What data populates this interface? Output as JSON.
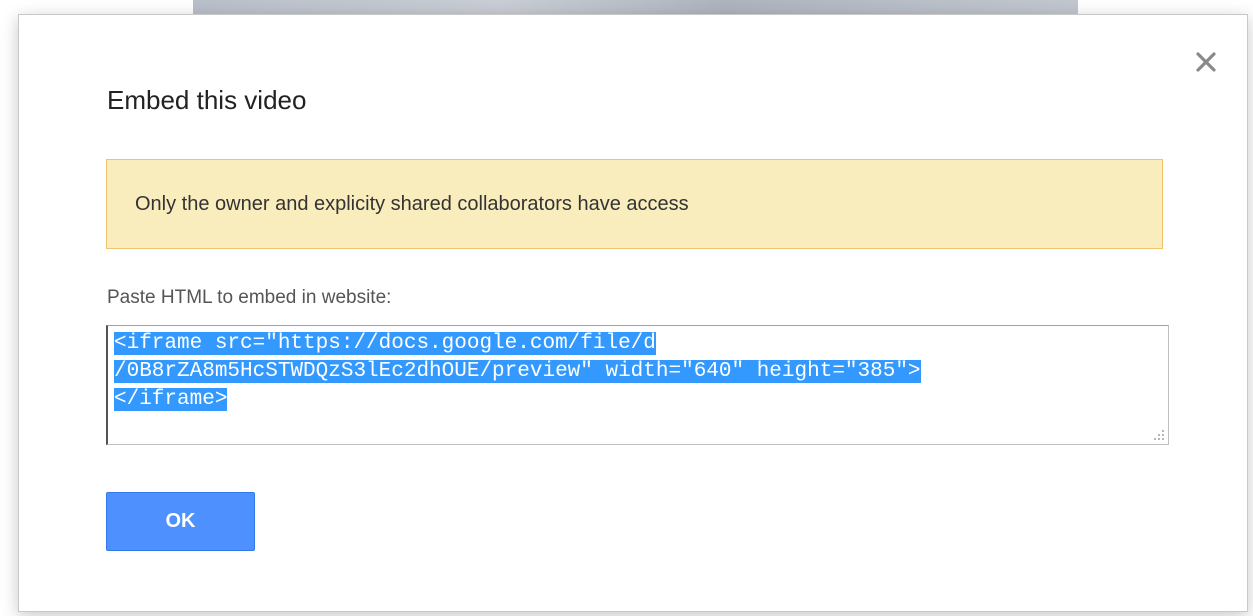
{
  "dialog": {
    "title": "Embed this video",
    "close_icon": "close-icon",
    "notice": {
      "text": "Only the owner and explicity shared collaborators have access",
      "background": "#f9edbe",
      "border": "#f0c36d"
    },
    "embed": {
      "label": "Paste HTML to embed in website:",
      "code_lines": [
        "<iframe src=\"https://docs.google.com/file/d",
        "/0B8rZA8m5HcSTWDQzS3lEc2dhOUE/preview\" width=\"640\" height=\"385\">",
        "</iframe>"
      ],
      "selection_color": "#3399ff"
    },
    "ok_button": {
      "label": "OK",
      "color": "#4d90fe"
    }
  }
}
